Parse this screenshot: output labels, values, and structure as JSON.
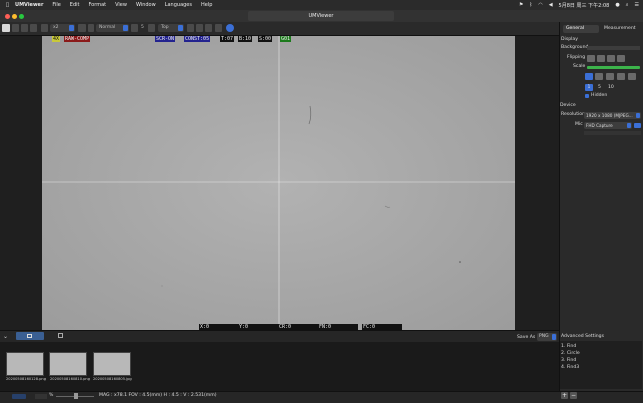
{
  "menubar": {
    "items": [
      "UMViewer",
      "File",
      "Edit",
      "Format",
      "View",
      "Window",
      "Languages",
      "Help"
    ],
    "datetime": "5月8日 周三 下午2:08"
  },
  "window": {
    "title": "UMViewer"
  },
  "toolbar": {
    "zoom_value": "x2",
    "mode_value": "Normal",
    "speed_value": "5",
    "position_value": "Top"
  },
  "overlay": {
    "top_row": [
      "4X",
      "RAW-COMP",
      "SCR-ON",
      "CONST:05",
      "T:07",
      "B:10",
      "S:00",
      "G01"
    ],
    "bottom_row": [
      "X:0",
      "Y:0",
      "CR:0",
      "FN:0",
      "FC:0"
    ]
  },
  "colors": {
    "viewport_bg": "#a8a8a8",
    "overlay_red": "#8b1a1a",
    "overlay_blue": "#23238f",
    "overlay_green": "#1c7a1c",
    "accent": "#3b6fd6",
    "green_bar": "#3cb44b"
  },
  "strip": {
    "save_as_label": "Save As",
    "save_format": "PNG"
  },
  "thumbnails": [
    {
      "caption": "20200508160128.png"
    },
    {
      "caption": "20200508160810.png"
    },
    {
      "caption": "20200508160805.jpg"
    }
  ],
  "status": {
    "zoom_unit": "%",
    "measure_text": "MAG : x78.1   FOV : 4.5(mm)   H : 4.5 : V : 2.531(mm)"
  },
  "panel": {
    "tabs": [
      "General",
      "Measurement"
    ],
    "display_heading": "Display",
    "background_label": "Background",
    "flipping_label": "Flipping",
    "scale_label": "Scale",
    "scale_options": [
      "1",
      "5",
      "10"
    ],
    "hidden_label": "Hidden",
    "device_heading": "Device",
    "resolution_label": "Resolution",
    "resolution_value": "1920 x 1080 (MJPEG...",
    "mic_label": "Mic",
    "mic_value": "FHD Capture",
    "advanced_heading": "Advanced Settings",
    "advanced_items": [
      "1. Find",
      "2. Circle",
      "3. Find",
      "4. Find3"
    ]
  }
}
